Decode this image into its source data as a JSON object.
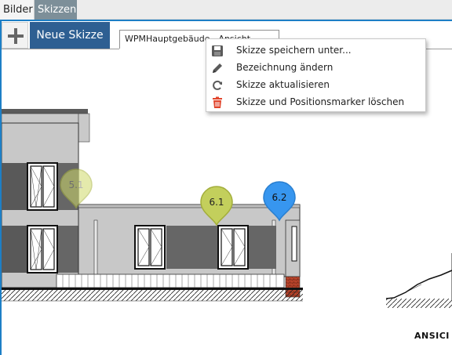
{
  "top_tabs": [
    {
      "label": "Bilder",
      "active": false
    },
    {
      "label": "Skizzen",
      "active": true
    }
  ],
  "toolbar": {
    "add_icon": "plus-icon",
    "new_sketch_label": "Neue Skizze"
  },
  "sketch_tabs": [
    {
      "label": "WPMHauptgebäude - Ansicht..."
    }
  ],
  "context_menu": {
    "items": [
      {
        "label": "Skizze speichern unter...",
        "icon": "save-icon",
        "color": "#555555"
      },
      {
        "label": "Bezeichnung ändern",
        "icon": "pencil-icon",
        "color": "#555555"
      },
      {
        "label": "Skizze aktualisieren",
        "icon": "refresh-icon",
        "color": "#555555"
      },
      {
        "label": "Skizze und Positionsmarker löschen",
        "icon": "trash-icon",
        "color": "#e1452c"
      }
    ]
  },
  "markers": [
    {
      "label": "5.1",
      "color": "#cfd96a",
      "state": "faded"
    },
    {
      "label": "6.1",
      "color": "#c3cf5c",
      "state": "normal"
    },
    {
      "label": "6.2",
      "color": "#3796ef",
      "state": "selected"
    }
  ],
  "drawing": {
    "footer_label": "ANSICI"
  },
  "colors": {
    "accent": "#1d7fc6",
    "primary_button": "#2e5f92",
    "active_tab": "#7d8f99"
  }
}
